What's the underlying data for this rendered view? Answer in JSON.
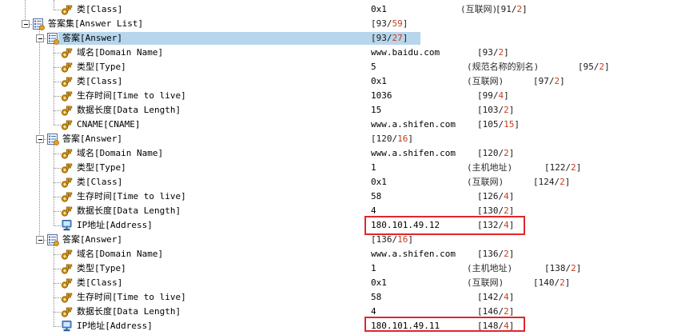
{
  "rows": [
    {
      "id": "r0",
      "level": 3,
      "kind": "leaf",
      "icon": "key",
      "label": "类[Class]",
      "value": "0x1",
      "note": "(互联网)",
      "offset_a": "91",
      "offset_b": "2"
    },
    {
      "id": "r1",
      "level": 1,
      "kind": "parent",
      "icon": "list",
      "label": "答案集[Answer List]",
      "value": "",
      "note": "",
      "offset_a": "93",
      "offset_b": "59"
    },
    {
      "id": "r2",
      "level": 2,
      "kind": "parent",
      "icon": "list",
      "label": "答案[Answer]",
      "value": "",
      "note": "",
      "offset_a": "93",
      "offset_b": "27",
      "selected": true
    },
    {
      "id": "r3",
      "level": 3,
      "kind": "leaf",
      "icon": "key",
      "label": "域名[Domain Name]",
      "value": "www.baidu.com",
      "note": "",
      "offset_a": "93",
      "offset_b": "2"
    },
    {
      "id": "r4",
      "level": 3,
      "kind": "leaf",
      "icon": "key",
      "label": "类型[Type]",
      "value": "5",
      "note": "(规范名称的别名)",
      "offset_a": "95",
      "offset_b": "2"
    },
    {
      "id": "r5",
      "level": 3,
      "kind": "leaf",
      "icon": "key",
      "label": "类[Class]",
      "value": "0x1",
      "note": "(互联网)",
      "offset_a": "97",
      "offset_b": "2"
    },
    {
      "id": "r6",
      "level": 3,
      "kind": "leaf",
      "icon": "key",
      "label": "生存时间[Time to live]",
      "value": "1036",
      "note": "",
      "offset_a": "99",
      "offset_b": "4"
    },
    {
      "id": "r7",
      "level": 3,
      "kind": "leaf",
      "icon": "key",
      "label": "数据长度[Data Length]",
      "value": "15",
      "note": "",
      "offset_a": "103",
      "offset_b": "2"
    },
    {
      "id": "r8",
      "level": 3,
      "kind": "leaf",
      "icon": "key",
      "label": "CNAME[CNAME]",
      "value": "www.a.shifen.com",
      "note": "",
      "offset_a": "105",
      "offset_b": "15"
    },
    {
      "id": "r9",
      "level": 2,
      "kind": "parent",
      "icon": "list",
      "label": "答案[Answer]",
      "value": "",
      "note": "",
      "offset_a": "120",
      "offset_b": "16"
    },
    {
      "id": "r10",
      "level": 3,
      "kind": "leaf",
      "icon": "key",
      "label": "域名[Domain Name]",
      "value": "www.a.shifen.com",
      "note": "",
      "offset_a": "120",
      "offset_b": "2"
    },
    {
      "id": "r11",
      "level": 3,
      "kind": "leaf",
      "icon": "key",
      "label": "类型[Type]",
      "value": "1",
      "note": "(主机地址)",
      "offset_a": "122",
      "offset_b": "2"
    },
    {
      "id": "r12",
      "level": 3,
      "kind": "leaf",
      "icon": "key",
      "label": "类[Class]",
      "value": "0x1",
      "note": "(互联网)",
      "offset_a": "124",
      "offset_b": "2"
    },
    {
      "id": "r13",
      "level": 3,
      "kind": "leaf",
      "icon": "key",
      "label": "生存时间[Time to live]",
      "value": "58",
      "note": "",
      "offset_a": "126",
      "offset_b": "4"
    },
    {
      "id": "r14",
      "level": 3,
      "kind": "leaf",
      "icon": "key",
      "label": "数据长度[Data Length]",
      "value": "4",
      "note": "",
      "offset_a": "130",
      "offset_b": "2"
    },
    {
      "id": "r15",
      "level": 3,
      "kind": "leaf",
      "icon": "ip",
      "label": "IP地址[Address]",
      "value": "180.101.49.12",
      "note": "",
      "offset_a": "132",
      "offset_b": "4",
      "highlight": true
    },
    {
      "id": "r16",
      "level": 2,
      "kind": "parent",
      "icon": "list",
      "label": "答案[Answer]",
      "value": "",
      "note": "",
      "offset_a": "136",
      "offset_b": "16"
    },
    {
      "id": "r17",
      "level": 3,
      "kind": "leaf",
      "icon": "key",
      "label": "域名[Domain Name]",
      "value": "www.a.shifen.com",
      "note": "",
      "offset_a": "136",
      "offset_b": "2"
    },
    {
      "id": "r18",
      "level": 3,
      "kind": "leaf",
      "icon": "key",
      "label": "类型[Type]",
      "value": "1",
      "note": "(主机地址)",
      "offset_a": "138",
      "offset_b": "2"
    },
    {
      "id": "r19",
      "level": 3,
      "kind": "leaf",
      "icon": "key",
      "label": "类[Class]",
      "value": "0x1",
      "note": "(互联网)",
      "offset_a": "140",
      "offset_b": "2"
    },
    {
      "id": "r20",
      "level": 3,
      "kind": "leaf",
      "icon": "key",
      "label": "生存时间[Time to live]",
      "value": "58",
      "note": "",
      "offset_a": "142",
      "offset_b": "4"
    },
    {
      "id": "r21",
      "level": 3,
      "kind": "leaf",
      "icon": "key",
      "label": "数据长度[Data Length]",
      "value": "4",
      "note": "",
      "offset_a": "146",
      "offset_b": "2"
    },
    {
      "id": "r22",
      "level": 3,
      "kind": "leaf",
      "icon": "ip",
      "label": "IP地址[Address]",
      "value": "180.101.49.11",
      "note": "",
      "offset_a": "148",
      "offset_b": "4",
      "highlight": true,
      "last": true
    }
  ],
  "colors": {
    "selection": "#b7d6ec",
    "highlight_box": "#e0262b",
    "offset_length": "#c83c1e",
    "guide_line": "#8a8a8a"
  }
}
